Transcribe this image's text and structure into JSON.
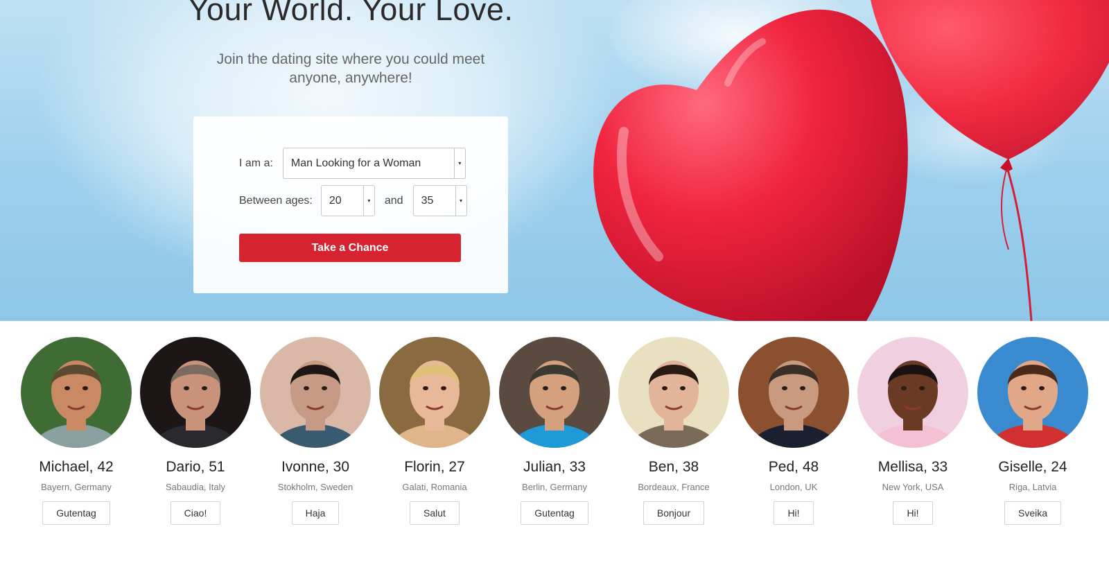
{
  "hero": {
    "headline": "Your World. Your Love.",
    "subline": "Join the dating site where you could meet anyone, anywhere!"
  },
  "form": {
    "iam_label": "I am a:",
    "iam_value": "Man Looking for a Woman",
    "ages_label": "Between ages:",
    "age_min": "20",
    "and_label": "and",
    "age_max": "35",
    "submit_label": "Take a Chance",
    "dropdown_arrow": "▾"
  },
  "colors": {
    "accent_red": "#d7222f",
    "balloon_red": "#f0243f",
    "sky_blue": "#9ccfec"
  },
  "profiles": [
    {
      "name": "Michael, 42",
      "location": "Bayern, Germany",
      "greeting": "Gutentag",
      "skin": "#c98a63",
      "hair": "#5b4a2f",
      "bg": "#3f6b35",
      "shirt": "#8aa0a0"
    },
    {
      "name": "Dario, 51",
      "location": "Sabaudia, Italy",
      "greeting": "Ciao!",
      "skin": "#c8937a",
      "hair": "#7a6a60",
      "bg": "#1c1616",
      "shirt": "#2a2a2e"
    },
    {
      "name": "Ivonne, 30",
      "location": "Stokholm, Sweden",
      "greeting": "Haja",
      "skin": "#c79a85",
      "hair": "#1e1614",
      "bg": "#d9b8a8",
      "shirt": "#3a5a70"
    },
    {
      "name": "Florin, 27",
      "location": "Galati, Romania",
      "greeting": "Salut",
      "skin": "#e8b898",
      "hair": "#e0c078",
      "bg": "#8a6a40",
      "shirt": "#e0b58a"
    },
    {
      "name": "Julian, 33",
      "location": "Berlin, Germany",
      "greeting": "Gutentag",
      "skin": "#d4a07e",
      "hair": "#3a3a34",
      "bg": "#5a4a40",
      "shirt": "#1f9ad6"
    },
    {
      "name": "Ben, 38",
      "location": "Bordeaux, France",
      "greeting": "Bonjour",
      "skin": "#e2b49a",
      "hair": "#2a1a14",
      "bg": "#e8e0c0",
      "shirt": "#7a6a58"
    },
    {
      "name": "Ped, 48",
      "location": "London, UK",
      "greeting": "Hi!",
      "skin": "#c99a80",
      "hair": "#3a2e26",
      "bg": "#8a5030",
      "shirt": "#1a2030"
    },
    {
      "name": "Mellisa, 33",
      "location": "New York, USA",
      "greeting": "Hi!",
      "skin": "#6a3a24",
      "hair": "#1a1210",
      "bg": "#f0d0e0",
      "shirt": "#f4c0d4"
    },
    {
      "name": "Giselle, 24",
      "location": "Riga, Latvia",
      "greeting": "Sveika",
      "skin": "#e0a888",
      "hair": "#4a2a18",
      "bg": "#3a8ad0",
      "shirt": "#d03030"
    }
  ]
}
